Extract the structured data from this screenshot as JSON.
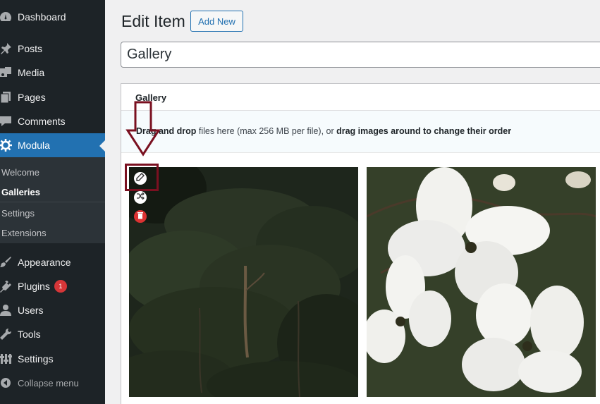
{
  "sidebar": {
    "items": [
      {
        "label": "Dashboard",
        "icon": "dashboard-icon"
      },
      {
        "label": "Posts",
        "icon": "pin-icon"
      },
      {
        "label": "Media",
        "icon": "media-icon"
      },
      {
        "label": "Pages",
        "icon": "pages-icon"
      },
      {
        "label": "Comments",
        "icon": "comments-icon"
      },
      {
        "label": "Modula",
        "icon": "gear-icon"
      },
      {
        "label": "Appearance",
        "icon": "paintbrush-icon"
      },
      {
        "label": "Plugins",
        "icon": "plug-icon",
        "badge": "1"
      },
      {
        "label": "Users",
        "icon": "user-icon"
      },
      {
        "label": "Tools",
        "icon": "wrench-icon"
      },
      {
        "label": "Settings",
        "icon": "settings-icon"
      }
    ],
    "submenu": [
      {
        "label": "Welcome"
      },
      {
        "label": "Galleries"
      },
      {
        "label": "Settings"
      },
      {
        "label": "Extensions"
      }
    ],
    "collapse_label": "Collapse menu"
  },
  "header": {
    "title": "Edit Item",
    "add_new_label": "Add New"
  },
  "title_field": {
    "value": "Gallery"
  },
  "panel": {
    "title": "Gallery",
    "dropzone": {
      "part1": "Drag and drop",
      "part2": " files here (max 256 MB per file), or ",
      "part3": "drag images around to change their order"
    }
  },
  "colors": {
    "sidebar_bg": "#1d2327",
    "accent": "#2271b1",
    "badge": "#d63638",
    "annotation": "#7a1020"
  }
}
